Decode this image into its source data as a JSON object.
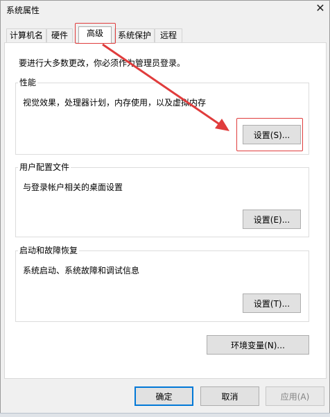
{
  "window": {
    "title": "系统属性"
  },
  "tabs": [
    {
      "label": "计算机名",
      "selected": false
    },
    {
      "label": "硬件",
      "selected": false
    },
    {
      "label": "高级",
      "selected": true
    },
    {
      "label": "系统保护",
      "selected": false
    },
    {
      "label": "远程",
      "selected": false
    }
  ],
  "admin_note": "要进行大多数更改，你必须作为管理员登录。",
  "performance": {
    "title": "性能",
    "description": "视觉效果，处理器计划，内存使用，以及虚拟内存",
    "button": "设置(S)..."
  },
  "user_profiles": {
    "title": "用户配置文件",
    "description": "与登录帐户相关的桌面设置",
    "button": "设置(E)..."
  },
  "startup_recovery": {
    "title": "启动和故障恢复",
    "description": "系统启动、系统故障和调试信息",
    "button": "设置(T)..."
  },
  "env_button": "环境变量(N)...",
  "footer": {
    "ok": "确定",
    "cancel": "取消",
    "apply": "应用(A)"
  },
  "annotation_color": "#e03c3c"
}
